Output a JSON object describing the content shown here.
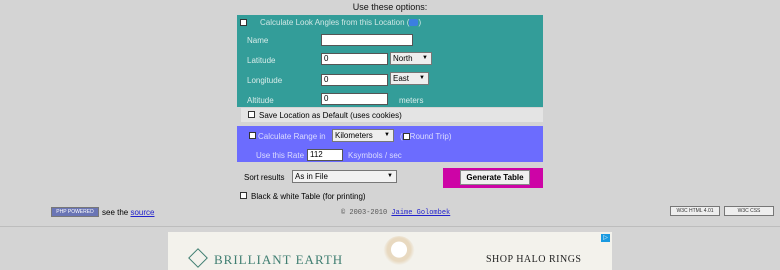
{
  "header": {
    "title": "Use these options:"
  },
  "location": {
    "calc_label": "Calculate Look Angles from this Location",
    "calc_paren_open": "(",
    "calc_paren_close": ")",
    "help_icon": "help-icon",
    "name_label": "Name",
    "name_value": "",
    "latitude_label": "Latitude",
    "latitude_value": "0",
    "latitude_dir": "North",
    "longitude_label": "Longitude",
    "longitude_value": "0",
    "longitude_dir": "East",
    "altitude_label": "Altitude",
    "altitude_value": "0",
    "altitude_unit": "meters",
    "save_default_label": "Save Location as Default (uses cookies)"
  },
  "range": {
    "calc_label": "Calculate Range in",
    "unit": "Kilometers",
    "round_trip_label": "Round Trip",
    "paren_open": "(",
    "paren_close": ")",
    "rate_label": "Use this Rate",
    "rate_value": "112",
    "rate_unit": "Ksymbols / sec"
  },
  "sort": {
    "label": "Sort results",
    "value": "As in File"
  },
  "generate_button": "Generate Table",
  "bw_label": "Black & white Table (for printing)",
  "footer": {
    "php_badge": "PHP POWERED",
    "see_text": "see the",
    "source_link": "source",
    "copyright": "© 2003-2010",
    "author_link": "Jaime Golombek",
    "w3c_html": "W3C HTML 4.01",
    "w3c_css": "W3C CSS"
  },
  "ad": {
    "brand": "BRILLIANT EARTH",
    "cta": "SHOP HALO RINGS"
  },
  "colors": {
    "teal_panel": "#339d99",
    "purple_panel": "#6c6cfe",
    "generate_frame": "#cd04a6"
  }
}
